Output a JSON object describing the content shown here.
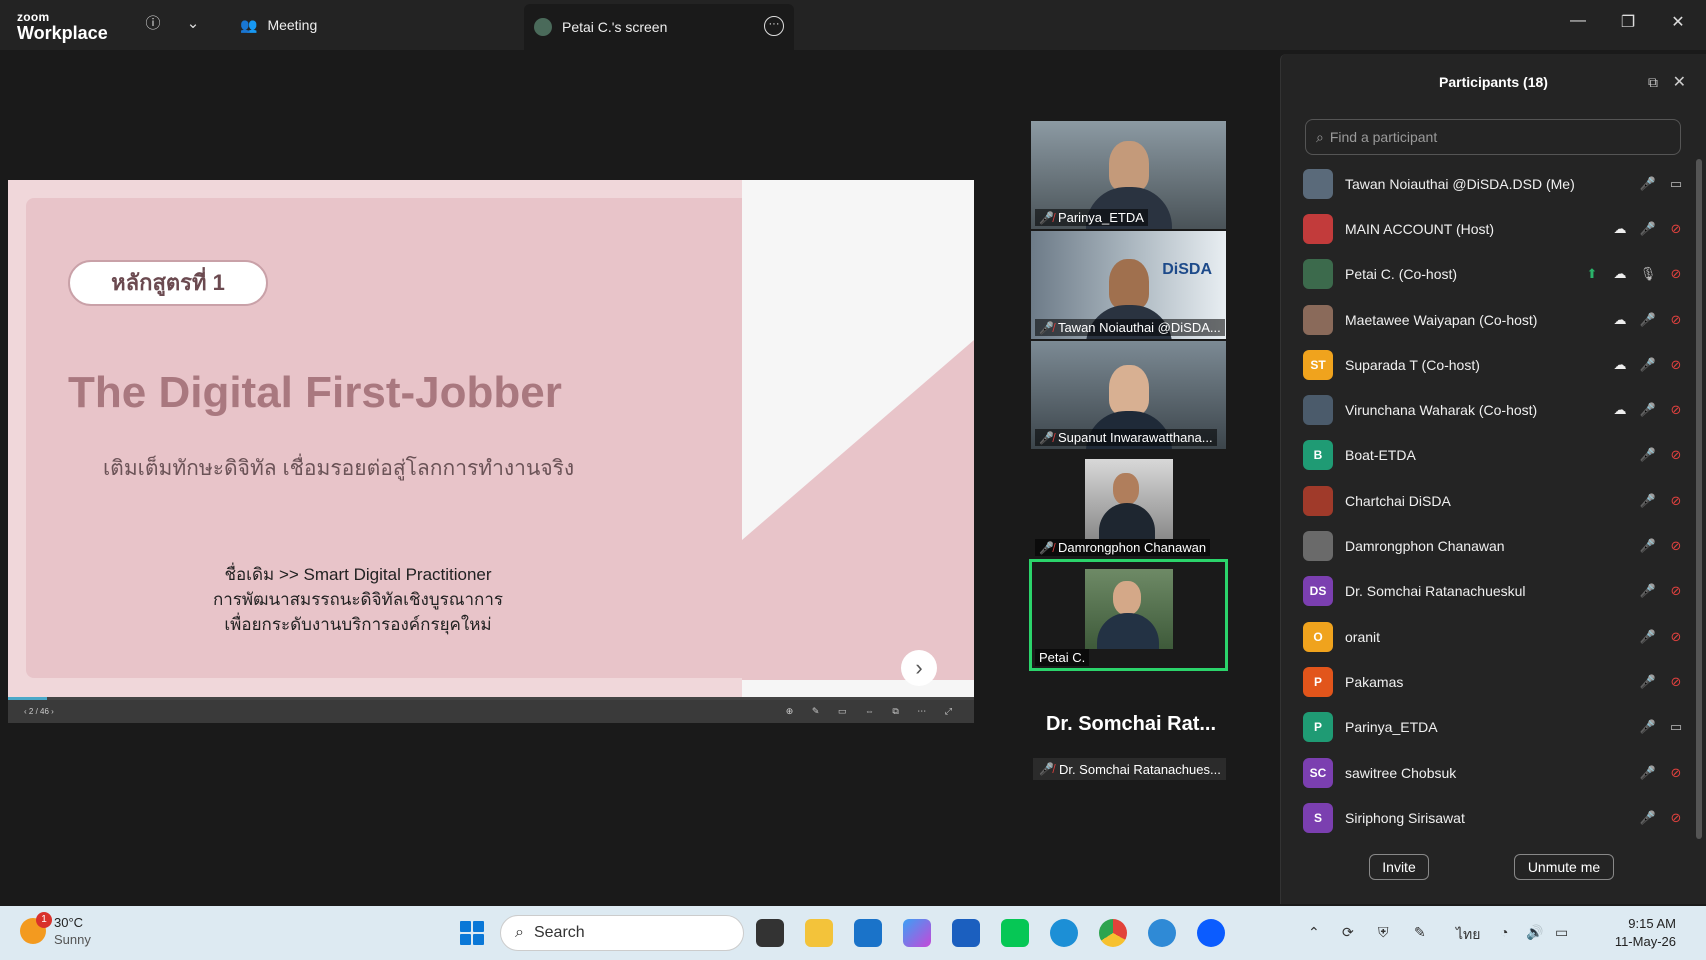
{
  "titlebar": {
    "logo_top": "zoom",
    "logo_bottom": "Workplace",
    "meeting_tab": "Meeting",
    "screen_tab": "Petai C.'s screen"
  },
  "slide": {
    "badge": "หลักสูตรที่ 1",
    "title": "The Digital First-Jobber",
    "subtitle": "เติมเต็มทักษะดิจิทัล เชื่อมรอยต่อสู่โลกการทำงานจริง",
    "line1": "ชื่อเดิม >> Smart Digital Practitioner",
    "line2": "การพัฒนาสมรรถนะดิจิทัลเชิงบูรณาการ",
    "line3": "เพื่อยกระดับงานบริการองค์กรยุคใหม่",
    "page": "2 / 46",
    "progress": 0.04
  },
  "videos": [
    {
      "name": "Parinya_ETDA"
    },
    {
      "name": "Tawan Noiauthai @DiSDA..."
    },
    {
      "name": "Supanut Inwarawatthana..."
    },
    {
      "name": "Damrongphon Chanawan"
    },
    {
      "name": "Petai C."
    }
  ],
  "speaker": {
    "big_name": "Dr. Somchai Rat...",
    "strip_name": "Dr. Somchai Ratanachues..."
  },
  "panel": {
    "title": "Participants (18)",
    "search_placeholder": "Find a participant",
    "invite": "Invite",
    "unmute": "Unmute me",
    "participants": [
      {
        "name": "Tawan Noiauthai @DiSDA.DSD (Me)",
        "initials": "",
        "color": "#5a6a7a",
        "cam": "on"
      },
      {
        "name": "MAIN ACCOUNT (Host)",
        "initials": "",
        "color": "#c23b3b",
        "cloud": true,
        "cam": "off"
      },
      {
        "name": "Petai C. (Co-host)",
        "initials": "",
        "color": "#3c6a4c",
        "share": true,
        "cloud": true,
        "mic": "on",
        "cam": "off"
      },
      {
        "name": "Maetawee Waiyapan (Co-host)",
        "initials": "",
        "color": "#8a6a5a",
        "cloud": true,
        "cam": "off"
      },
      {
        "name": "Suparada T (Co-host)",
        "initials": "ST",
        "color": "#f0a31d",
        "cloud": true,
        "cam": "off"
      },
      {
        "name": "Virunchana Waharak (Co-host)",
        "initials": "",
        "color": "#4b5b6b",
        "cloud": true,
        "cam": "off"
      },
      {
        "name": "Boat-ETDA",
        "initials": "B",
        "color": "#1f9b74",
        "cam": "off"
      },
      {
        "name": "Chartchai DiSDA",
        "initials": "",
        "color": "#a03a2a",
        "cam": "off"
      },
      {
        "name": "Damrongphon Chanawan",
        "initials": "",
        "color": "#6a6a6a",
        "cam": "off"
      },
      {
        "name": "Dr. Somchai Ratanachueskul",
        "initials": "DS",
        "color": "#7b3fb0",
        "cam": "off"
      },
      {
        "name": "oranit",
        "initials": "O",
        "color": "#f0a31d",
        "cam": "off"
      },
      {
        "name": "Pakamas",
        "initials": "P",
        "color": "#e2551b",
        "cam": "off"
      },
      {
        "name": "Parinya_ETDA",
        "initials": "P",
        "color": "#1f9b74",
        "cam": "on"
      },
      {
        "name": "sawitree Chobsuk",
        "initials": "SC",
        "color": "#7b3fb0",
        "cam": "off"
      },
      {
        "name": "Siriphong Sirisawat",
        "initials": "S",
        "color": "#7b3fb0",
        "cam": "off"
      }
    ]
  },
  "taskbar": {
    "temp": "30°C",
    "condition": "Sunny",
    "weather_badge": "1",
    "search": "Search",
    "lang": "ไทย",
    "time": "9:15 AM",
    "date": "11-May-26"
  }
}
